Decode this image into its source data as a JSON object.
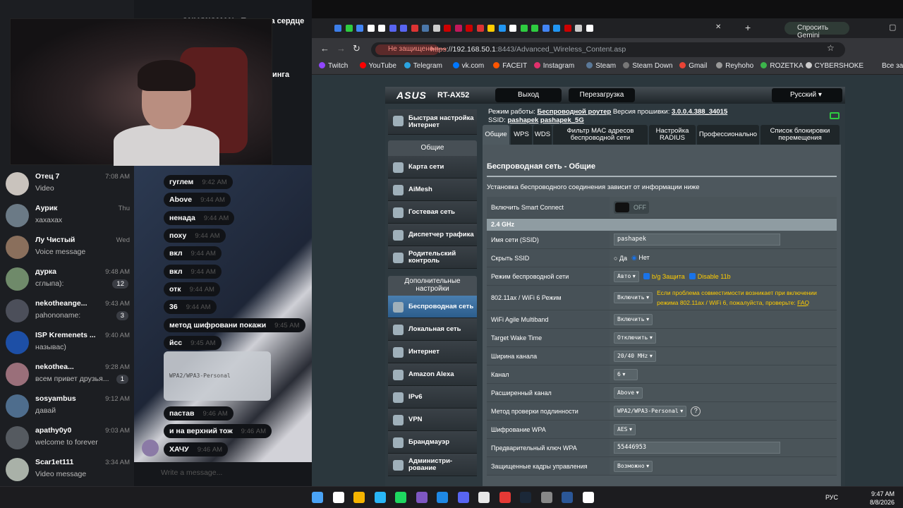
{
  "telegram": {
    "top_title": "ONLYWOMAN - Потап на сердце (AINETTOCCE",
    "top_right": "инга",
    "chats": [
      {
        "name": "Отец 7",
        "time": "7:08 AM",
        "preview": "Video",
        "color": "#c9c3bd"
      },
      {
        "name": "Аурик",
        "time": "Thu",
        "preview": "хахахах",
        "color": "#6b7a86"
      },
      {
        "name": "Лу Чистый",
        "time": "Wed",
        "preview": "Voice message",
        "color": "#8a6f5c"
      },
      {
        "name": "дурка",
        "time": "9:48 AM",
        "preview": "сглыпа):",
        "badge": "12",
        "color": "#6f8a6a"
      },
      {
        "name": "nekotheange...",
        "time": "9:43 AM",
        "preview": "pahononame:",
        "badge": "3",
        "color": "#4c4f5a"
      },
      {
        "name": "ISP Kremenets ...",
        "time": "9:40 AM",
        "preview": "называс)",
        "color": "#1d4fa6"
      },
      {
        "name": "nekothea...",
        "time": "9:28 AM",
        "preview": "всем привет друзья...",
        "badge": "1",
        "color": "#9a6f7a"
      },
      {
        "name": "sosyambus",
        "time": "9:12 AM",
        "preview": "давай",
        "color": "#4e6d8d"
      },
      {
        "name": "apathy0y0",
        "time": "9:03 AM",
        "preview": "welcome to forever",
        "color": "#555a60"
      },
      {
        "name": "Scar1et111",
        "time": "3:34 AM",
        "preview": "Video message",
        "color": "#a9b1a8"
      }
    ],
    "messages": [
      {
        "text": "гуглем",
        "time": "9:42 AM"
      },
      {
        "text": "Above",
        "time": "9:44 AM"
      },
      {
        "text": "ненада",
        "time": "9:44 AM"
      },
      {
        "text": "поху",
        "time": "9:44 AM"
      },
      {
        "text": "вкл",
        "time": "9:44 AM"
      },
      {
        "text": "вкл",
        "time": "9:44 AM"
      },
      {
        "text": "отк",
        "time": "9:44 AM"
      },
      {
        "text": "36",
        "time": "9:44 AM"
      },
      {
        "text": "метод шифровани покажи",
        "time": "9:45 AM"
      },
      {
        "text": "йсс",
        "time": "9:45 AM"
      },
      {
        "text": "пастав",
        "time": "9:46 AM"
      },
      {
        "text": "и на верхний тож",
        "time": "9:46 AM"
      },
      {
        "text": "ХАЧУ",
        "time": "9:46 AM"
      }
    ],
    "photo_text": "WPA2/WPA3-Personal",
    "input_placeholder": "Write a message..."
  },
  "browser": {
    "gemini": "Спросить Gemini",
    "not_secure": "Не защищено",
    "url_scheme": "https",
    "url_host": "://192.168.50.1",
    "url_rest": ":8443/Advanced_Wireless_Content.asp",
    "bookmarks": [
      {
        "label": "Twitch",
        "color": "#9146ff"
      },
      {
        "label": "YouTube",
        "color": "#ff0000"
      },
      {
        "label": "Telegram",
        "color": "#2aa3e0"
      },
      {
        "label": "vk.com",
        "color": "#0077ff"
      },
      {
        "label": "FACEIT",
        "color": "#ff5500"
      },
      {
        "label": "Instagram",
        "color": "#e1306c"
      },
      {
        "label": "Steam",
        "color": "#5a7898"
      },
      {
        "label": "Steam Down",
        "color": "#777"
      },
      {
        "label": "Gmail",
        "color": "#ea4335"
      },
      {
        "label": "Reyhoho",
        "color": "#999"
      },
      {
        "label": "ROZETKA",
        "color": "#3cb44b"
      },
      {
        "label": "CYBERSHOKE",
        "color": "#ccc"
      }
    ],
    "all_bookmarks": "Все закл"
  },
  "asus": {
    "logo": "ASUS",
    "model": "RT-AX52",
    "logout": "Выход",
    "reboot": "Перезагрузка",
    "language": "Русский",
    "mode_label": "Режим работы:",
    "mode_value": "Беспроводной роутер",
    "fw_label": "Версия прошивки:",
    "fw_value": "3.0.0.4.388_34015",
    "ssid_label": "SSID:",
    "ssid1": "pashapek",
    "ssid2": "pashapek_5G",
    "menu_top": "Быстрая настройка Интернет",
    "general_header": "Общие",
    "general_items": [
      "Карта сети",
      "AiMesh",
      "Гостевая сеть",
      "Диспетчер трафика",
      "Родительский контроль"
    ],
    "advanced_header": "Дополнительные настройки",
    "advanced_items": [
      "Беспроводная сеть",
      "Локальная сеть",
      "Интернет",
      "Amazon Alexa",
      "IPv6",
      "VPN",
      "Брандмауэр",
      "Администри-рование"
    ],
    "tabs": [
      "Общие",
      "WPS",
      "WDS",
      "Фильтр MAC адресов беспроводной сети",
      "Настройка RADIUS",
      "Профессионально",
      "Список блокировки перемещения"
    ],
    "title": "Беспроводная сеть - Общие",
    "description": "Установка беспроводного соединения зависит от информации ниже",
    "smart_connect_label": "Включить Smart Connect",
    "smart_connect_value": "OFF",
    "band": "2.4 GHz",
    "fields": {
      "ssid_label": "Имя сети (SSID)",
      "ssid_value": "pashapek",
      "hide_label": "Скрыть SSID",
      "hide_yes": "Да",
      "hide_no": "Нет",
      "mode_label": "Режим беспроводной сети",
      "mode_value": "Авто",
      "bg_protect": "b/g Защита",
      "disable11b": "Disable 11b",
      "ax_label": "802.11ax / WiFi 6 Режим",
      "ax_value": "Включить",
      "ax_note": "Если проблема совместимости возникает при включении режима 802.11ax / WiFi 6, пожалуйста, проверьте:",
      "faq": "FAQ",
      "agile_label": "WiFi Agile Multiband",
      "agile_value": "Включить",
      "twt_label": "Target Wake Time",
      "twt_value": "Отключить",
      "bw_label": "Ширина канала",
      "bw_value": "20/40 MHz",
      "ch_label": "Канал",
      "ch_value": "6",
      "ext_label": "Расширенный канал",
      "ext_value": "Above",
      "auth_label": "Метод проверки подлинности",
      "auth_value": "WPA2/WPA3-Personal",
      "enc_label": "Шифрование WPA",
      "enc_value": "AES",
      "key_label": "Предварительный ключ WPA",
      "key_value": "55446953",
      "pmf_label": "Защищенные кадры управления",
      "pmf_value": "Возможно"
    }
  },
  "taskbar": {
    "lang": "РУС",
    "time": "9:47 AM",
    "date": "8/8/2026"
  }
}
